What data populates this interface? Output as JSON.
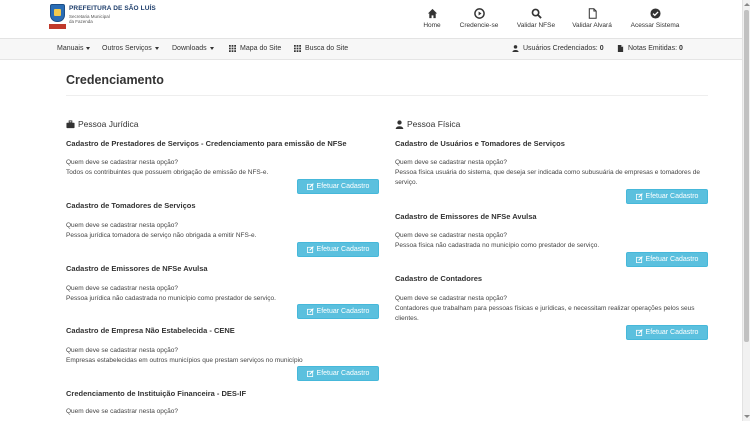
{
  "brand": {
    "title": "PREFEITURA DE SÃO LUÍS",
    "subtitle_line1": "Secretaria Municipal",
    "subtitle_line2": "da Fazenda"
  },
  "top_nav": [
    {
      "label": "Home",
      "icon": "home-icon"
    },
    {
      "label": "Credencie-se",
      "icon": "play-circle-icon"
    },
    {
      "label": "Validar NFSe",
      "icon": "search-icon"
    },
    {
      "label": "Validar Alvará",
      "icon": "document-icon"
    },
    {
      "label": "Acessar Sistema",
      "icon": "check-circle-icon"
    }
  ],
  "secondary_nav": {
    "manuais": "Manuais",
    "outros_servicos": "Outros Serviços",
    "downloads": "Downloads",
    "mapa_site": "Mapa do Site",
    "busca_site": "Busca do Site",
    "usuarios_label": "Usuários Credenciados:",
    "usuarios_count": "0",
    "notas_label": "Notas Emitidas:",
    "notas_count": "0"
  },
  "page": {
    "title": "Credenciamento"
  },
  "button_label": "Efetuar Cadastro",
  "pessoa_juridica": {
    "heading": "Pessoa Jurídica",
    "sections": [
      {
        "title": "Cadastro de Prestadores de Serviços - Credenciamento para emissão de NFSe",
        "question": "Quem deve se cadastrar nesta opção?",
        "answer": "Todos os contribuintes que possuem obrigação de emissão de NFS-e."
      },
      {
        "title": "Cadastro de Tomadores de Serviços",
        "question": "Quem deve se cadastrar nesta opção?",
        "answer": "Pessoa jurídica tomadora de serviço não obrigada a emitir NFS-e."
      },
      {
        "title": "Cadastro de Emissores de NFSe Avulsa",
        "question": "Quem deve se cadastrar nesta opção?",
        "answer": "Pessoa jurídica não cadastrada no município como prestador de serviço."
      },
      {
        "title": "Cadastro de Empresa Não Estabelecida - CENE",
        "question": "Quem deve se cadastrar nesta opção?",
        "answer": "Empresas estabelecidas em outros municípios que prestam serviços no município"
      },
      {
        "title": "Credenciamento de Instituição Financeira - DES-IF",
        "question": "Quem deve se cadastrar nesta opção?",
        "answer": ""
      }
    ]
  },
  "pessoa_fisica": {
    "heading": "Pessoa Física",
    "sections": [
      {
        "title": "Cadastro de Usuários e Tomadores de Serviços",
        "question": "Quem deve se cadastrar nesta opção?",
        "answer": "Pessoa física usuária do sistema, que deseja ser indicada como subusuária de empresas e tomadores de serviço."
      },
      {
        "title": "Cadastro de Emissores de NFSe Avulsa",
        "question": "Quem deve se cadastrar nesta opção?",
        "answer": "Pessoa física não cadastrada no município como prestador de serviço."
      },
      {
        "title": "Cadastro de Contadores",
        "question": "Quem deve se cadastrar nesta opção?",
        "answer": "Contadores que trabalham para pessoas físicas e jurídicas, e necessitam realizar operações pelos seus clientes."
      }
    ]
  },
  "colors": {
    "button_bg": "#5bc0de",
    "button_border": "#46b8da"
  }
}
